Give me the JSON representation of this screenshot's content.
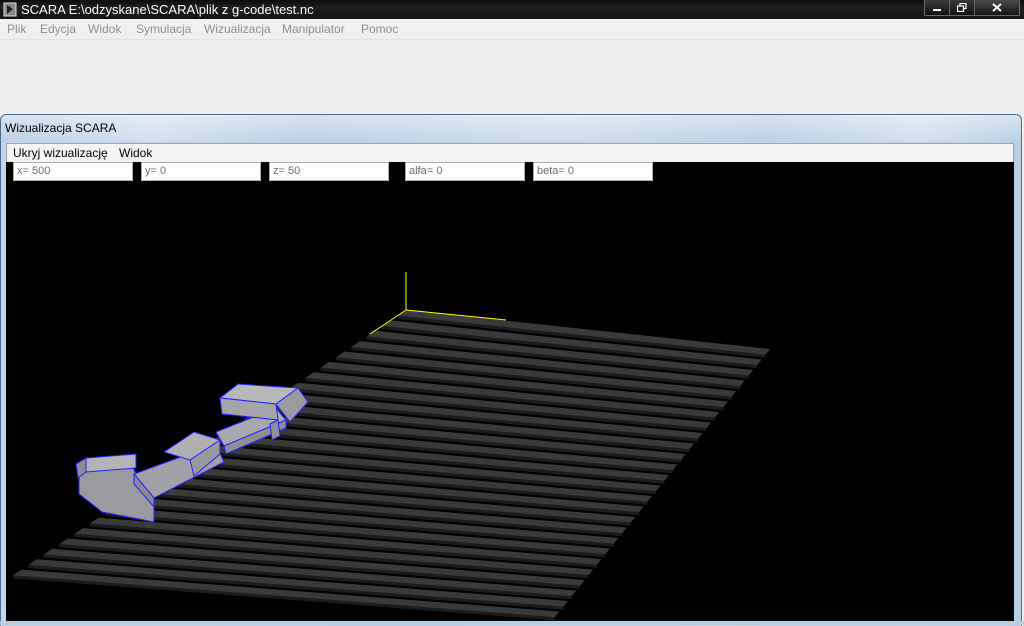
{
  "window": {
    "title": "SCARA E:\\odzyskane\\SCARA\\plik z g-code\\test.nc",
    "controls": [
      "minimize-icon",
      "restore-icon",
      "close-icon"
    ]
  },
  "main_menu": {
    "items": [
      "Plik",
      "Edycja",
      "Widok",
      "Symulacja",
      "Wizualizacja",
      "Manipulator",
      "Pomoc"
    ]
  },
  "child_window": {
    "title": "Wizualizacja SCARA",
    "menu": [
      "Ukryj wizualizację",
      "Widok"
    ],
    "fields": [
      "x= 500",
      "y= 0",
      "z= 50",
      "alfa= 0",
      "beta= 0"
    ]
  },
  "colors": {
    "viewport_bg": "#000000",
    "floor_stripe": "#3a3a3a",
    "robot_fill": "#a8a8ac",
    "robot_edge": "#2020ff",
    "axis_line": "#ffff00"
  }
}
